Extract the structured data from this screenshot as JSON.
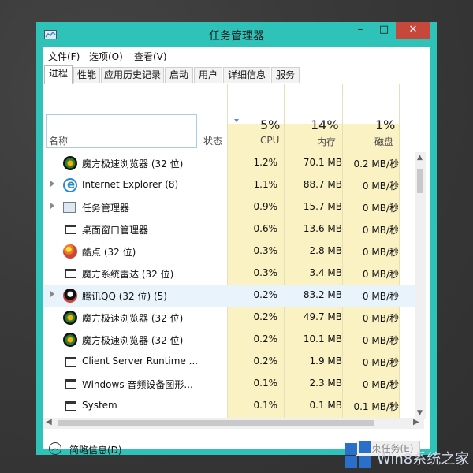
{
  "window": {
    "title": "任务管理器",
    "min_glyph": "–",
    "max_glyph": "□",
    "close_glyph": "✕"
  },
  "menu": [
    "文件(F)",
    "选项(O)",
    "查看(V)"
  ],
  "tabs": [
    {
      "label": "进程",
      "active": true
    },
    {
      "label": "性能",
      "active": false
    },
    {
      "label": "应用历史记录",
      "active": false
    },
    {
      "label": "启动",
      "active": false
    },
    {
      "label": "用户",
      "active": false
    },
    {
      "label": "详细信息",
      "active": false
    },
    {
      "label": "服务",
      "active": false
    }
  ],
  "columns": {
    "name": "名称",
    "status": "状态",
    "cpu": {
      "pct": "5%",
      "label": "CPU"
    },
    "mem": {
      "pct": "14%",
      "label": "内存"
    },
    "disk": {
      "pct": "1%",
      "label": "磁盘"
    }
  },
  "rows": [
    {
      "name": "魔方极速浏览器 (32 位)",
      "cpu": "1.2%",
      "mem": "70.1 MB",
      "disk": "0.2 MB/秒",
      "icon": "browser-icon",
      "expand": false,
      "highlight": false
    },
    {
      "name": "Internet Explorer (8)",
      "cpu": "1.1%",
      "mem": "88.7 MB",
      "disk": "0 MB/秒",
      "icon": "ie-icon",
      "expand": true,
      "highlight": false
    },
    {
      "name": "任务管理器",
      "cpu": "0.9%",
      "mem": "15.7 MB",
      "disk": "0 MB/秒",
      "icon": "task-manager-icon",
      "expand": true,
      "highlight": false
    },
    {
      "name": "桌面窗口管理器",
      "cpu": "0.6%",
      "mem": "13.6 MB",
      "disk": "0 MB/秒",
      "icon": "window-icon",
      "expand": false,
      "highlight": false
    },
    {
      "name": "酷点 (32 位)",
      "cpu": "0.3%",
      "mem": "2.8 MB",
      "disk": "0 MB/秒",
      "icon": "kudian-icon",
      "expand": false,
      "highlight": false
    },
    {
      "name": "魔方系统雷达 (32 位)",
      "cpu": "0.3%",
      "mem": "3.4 MB",
      "disk": "0 MB/秒",
      "icon": "window-icon",
      "expand": false,
      "highlight": false
    },
    {
      "name": "腾讯QQ (32 位) (5)",
      "cpu": "0.2%",
      "mem": "83.2 MB",
      "disk": "0 MB/秒",
      "icon": "qq-icon",
      "expand": true,
      "highlight": true
    },
    {
      "name": "魔方极速浏览器 (32 位)",
      "cpu": "0.2%",
      "mem": "49.7 MB",
      "disk": "0 MB/秒",
      "icon": "browser-icon",
      "expand": false,
      "highlight": false
    },
    {
      "name": "魔方极速浏览器 (32 位)",
      "cpu": "0.2%",
      "mem": "10.1 MB",
      "disk": "0 MB/秒",
      "icon": "browser-icon",
      "expand": false,
      "highlight": false
    },
    {
      "name": "Client Server Runtime ...",
      "cpu": "0.2%",
      "mem": "1.9 MB",
      "disk": "0 MB/秒",
      "icon": "window-icon",
      "expand": false,
      "highlight": false
    },
    {
      "name": "Windows 音频设备图形...",
      "cpu": "0.1%",
      "mem": "2.3 MB",
      "disk": "0 MB/秒",
      "icon": "window-icon",
      "expand": false,
      "highlight": false
    },
    {
      "name": "System",
      "cpu": "0.1%",
      "mem": "0.1 MB",
      "disk": "0.1 MB/秒",
      "icon": "window-icon",
      "expand": false,
      "highlight": false
    }
  ],
  "footer": {
    "fewer_details": "简略信息(D)",
    "end_task": "结束任务(E)"
  },
  "watermark": "Win8系统之家",
  "colors": {
    "frame": "#2fc2b8",
    "close": "#c7473a",
    "heat": "#fbf2c4"
  }
}
